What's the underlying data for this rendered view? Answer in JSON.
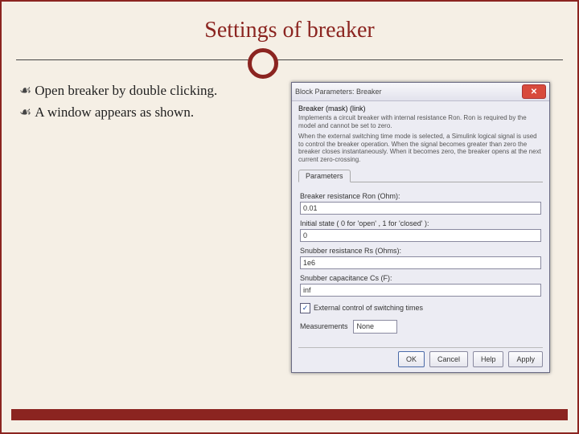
{
  "slide": {
    "title": "Settings of breaker",
    "bullet1": "Open breaker by double clicking.",
    "bullet2": "A window appears as shown."
  },
  "dialog": {
    "title": "Block Parameters: Breaker",
    "heading": "Breaker (mask) (link)",
    "desc1": "Implements a circuit breaker with internal resistance Ron. Ron is required by the model and cannot be set to zero.",
    "desc2": "When the external switching time mode is selected, a Simulink logical signal is used to control the breaker operation. When the signal becomes greater than zero the breaker closes instantaneously. When it becomes zero, the breaker opens at the next current zero-crossing.",
    "tab": "Parameters",
    "field_ron_label": "Breaker resistance Ron (Ohm):",
    "field_ron_value": "0.01",
    "field_initial_label": "Initial state ( 0 for 'open' , 1 for 'closed' ):",
    "field_initial_value": "0",
    "field_rs_label": "Snubber resistance Rs (Ohms):",
    "field_rs_value": "1e6",
    "field_cs_label": "Snubber capacitance Cs (F):",
    "field_cs_value": "inf",
    "checkbox_label": "External control of switching times",
    "measurements_label": "Measurements",
    "measurements_value": "None",
    "buttons": {
      "ok": "OK",
      "cancel": "Cancel",
      "help": "Help",
      "apply": "Apply"
    }
  }
}
